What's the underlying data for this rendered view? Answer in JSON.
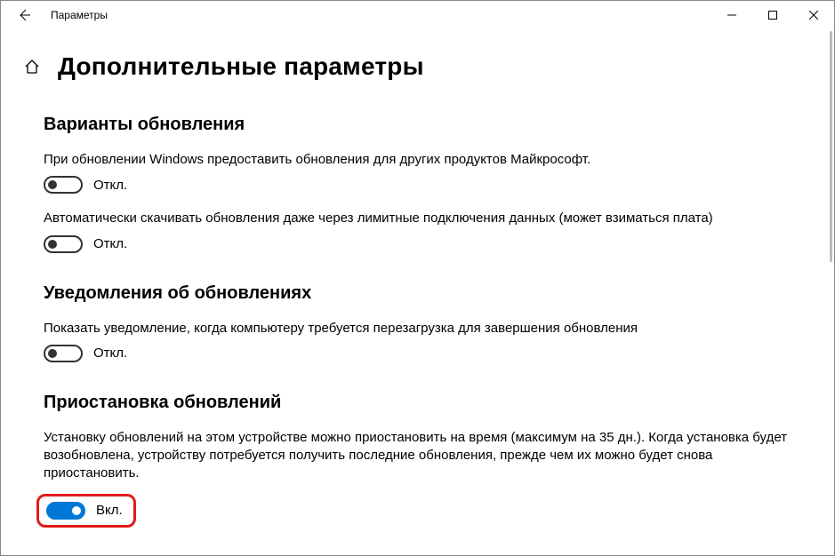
{
  "window": {
    "title": "Параметры"
  },
  "page": {
    "title": "Дополнительные параметры"
  },
  "sections": {
    "updateOptions": {
      "heading": "Варианты обновления",
      "opt1": {
        "label": "При обновлении Windows предоставить обновления для других продуктов Майкрософт.",
        "state": "Откл."
      },
      "opt2": {
        "label": "Автоматически скачивать обновления даже через лимитные подключения данных (может взиматься плата)",
        "state": "Откл."
      }
    },
    "notifications": {
      "heading": "Уведомления об обновлениях",
      "opt1": {
        "label": "Показать уведомление, когда компьютеру требуется перезагрузка для завершения обновления",
        "state": "Откл."
      }
    },
    "pause": {
      "heading": "Приостановка обновлений",
      "description": "Установку обновлений на этом устройстве можно приостановить на время (максимум на 35 дн.). Когда установка будет возобновлена, устройству потребуется получить последние обновления, прежде чем их можно будет снова приостановить.",
      "state": "Вкл."
    }
  }
}
